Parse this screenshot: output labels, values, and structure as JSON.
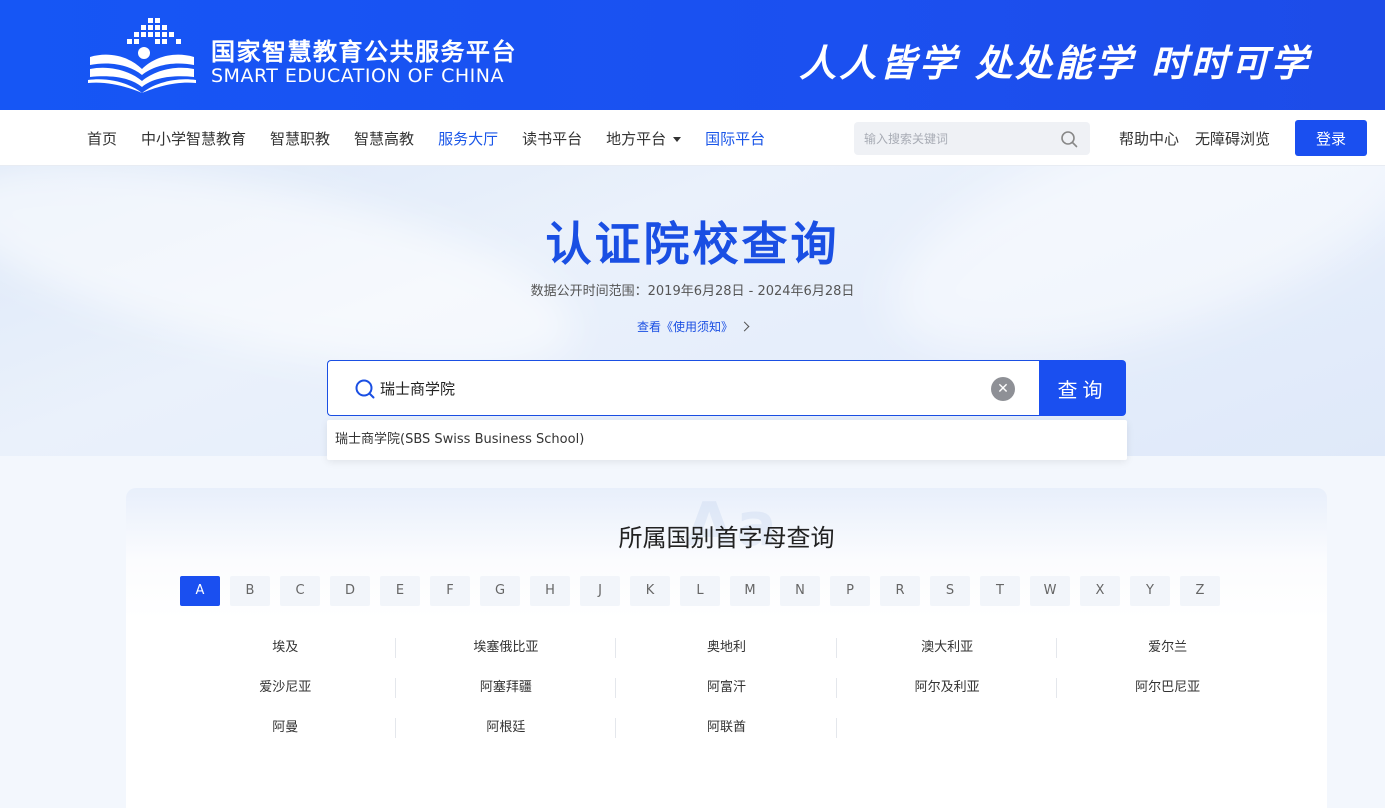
{
  "header": {
    "brand_cn": "国家智慧教育公共服务平台",
    "brand_en": "SMART EDUCATION OF CHINA",
    "slogan": "人人皆学 处处能学 时时可学",
    "logo_icon": "open-book-logo-icon"
  },
  "nav": {
    "items": [
      {
        "label": "首页",
        "active": false
      },
      {
        "label": "中小学智慧教育",
        "active": false
      },
      {
        "label": "智慧职教",
        "active": false
      },
      {
        "label": "智慧高教",
        "active": false
      },
      {
        "label": "服务大厅",
        "active": true
      },
      {
        "label": "读书平台",
        "active": false
      },
      {
        "label": "地方平台",
        "active": false,
        "has_dropdown": true
      },
      {
        "label": "国际平台",
        "active": true
      }
    ],
    "search_placeholder": "输入搜索关键词",
    "help": "帮助中心",
    "accessibility": "无障碍浏览",
    "login": "登录"
  },
  "hero": {
    "title": "认证院校查询",
    "date_range": "数据公开时间范围：2019年6月28日 - 2024年6月28日",
    "notice_link": "查看《使用须知》"
  },
  "search": {
    "value": "瑞士商学院",
    "button": "查询",
    "suggestions": [
      "瑞士商学院(SBS Swiss Business School)"
    ]
  },
  "country_section": {
    "title": "所属国别首字母查询",
    "letters": [
      "A",
      "B",
      "C",
      "D",
      "E",
      "F",
      "G",
      "H",
      "J",
      "K",
      "L",
      "M",
      "N",
      "P",
      "R",
      "S",
      "T",
      "W",
      "X",
      "Y",
      "Z"
    ],
    "active_letter": "A",
    "countries": [
      [
        "埃及",
        "埃塞俄比亚",
        "奥地利",
        "澳大利亚",
        "爱尔兰"
      ],
      [
        "爱沙尼亚",
        "阿塞拜疆",
        "阿富汗",
        "阿尔及利亚",
        "阿尔巴尼亚"
      ],
      [
        "阿曼",
        "阿根廷",
        "阿联酋"
      ]
    ]
  },
  "colors": {
    "brand_blue": "#1a4ff0",
    "title_blue": "#1a4fe3",
    "banner_blue": "#1656f5"
  }
}
